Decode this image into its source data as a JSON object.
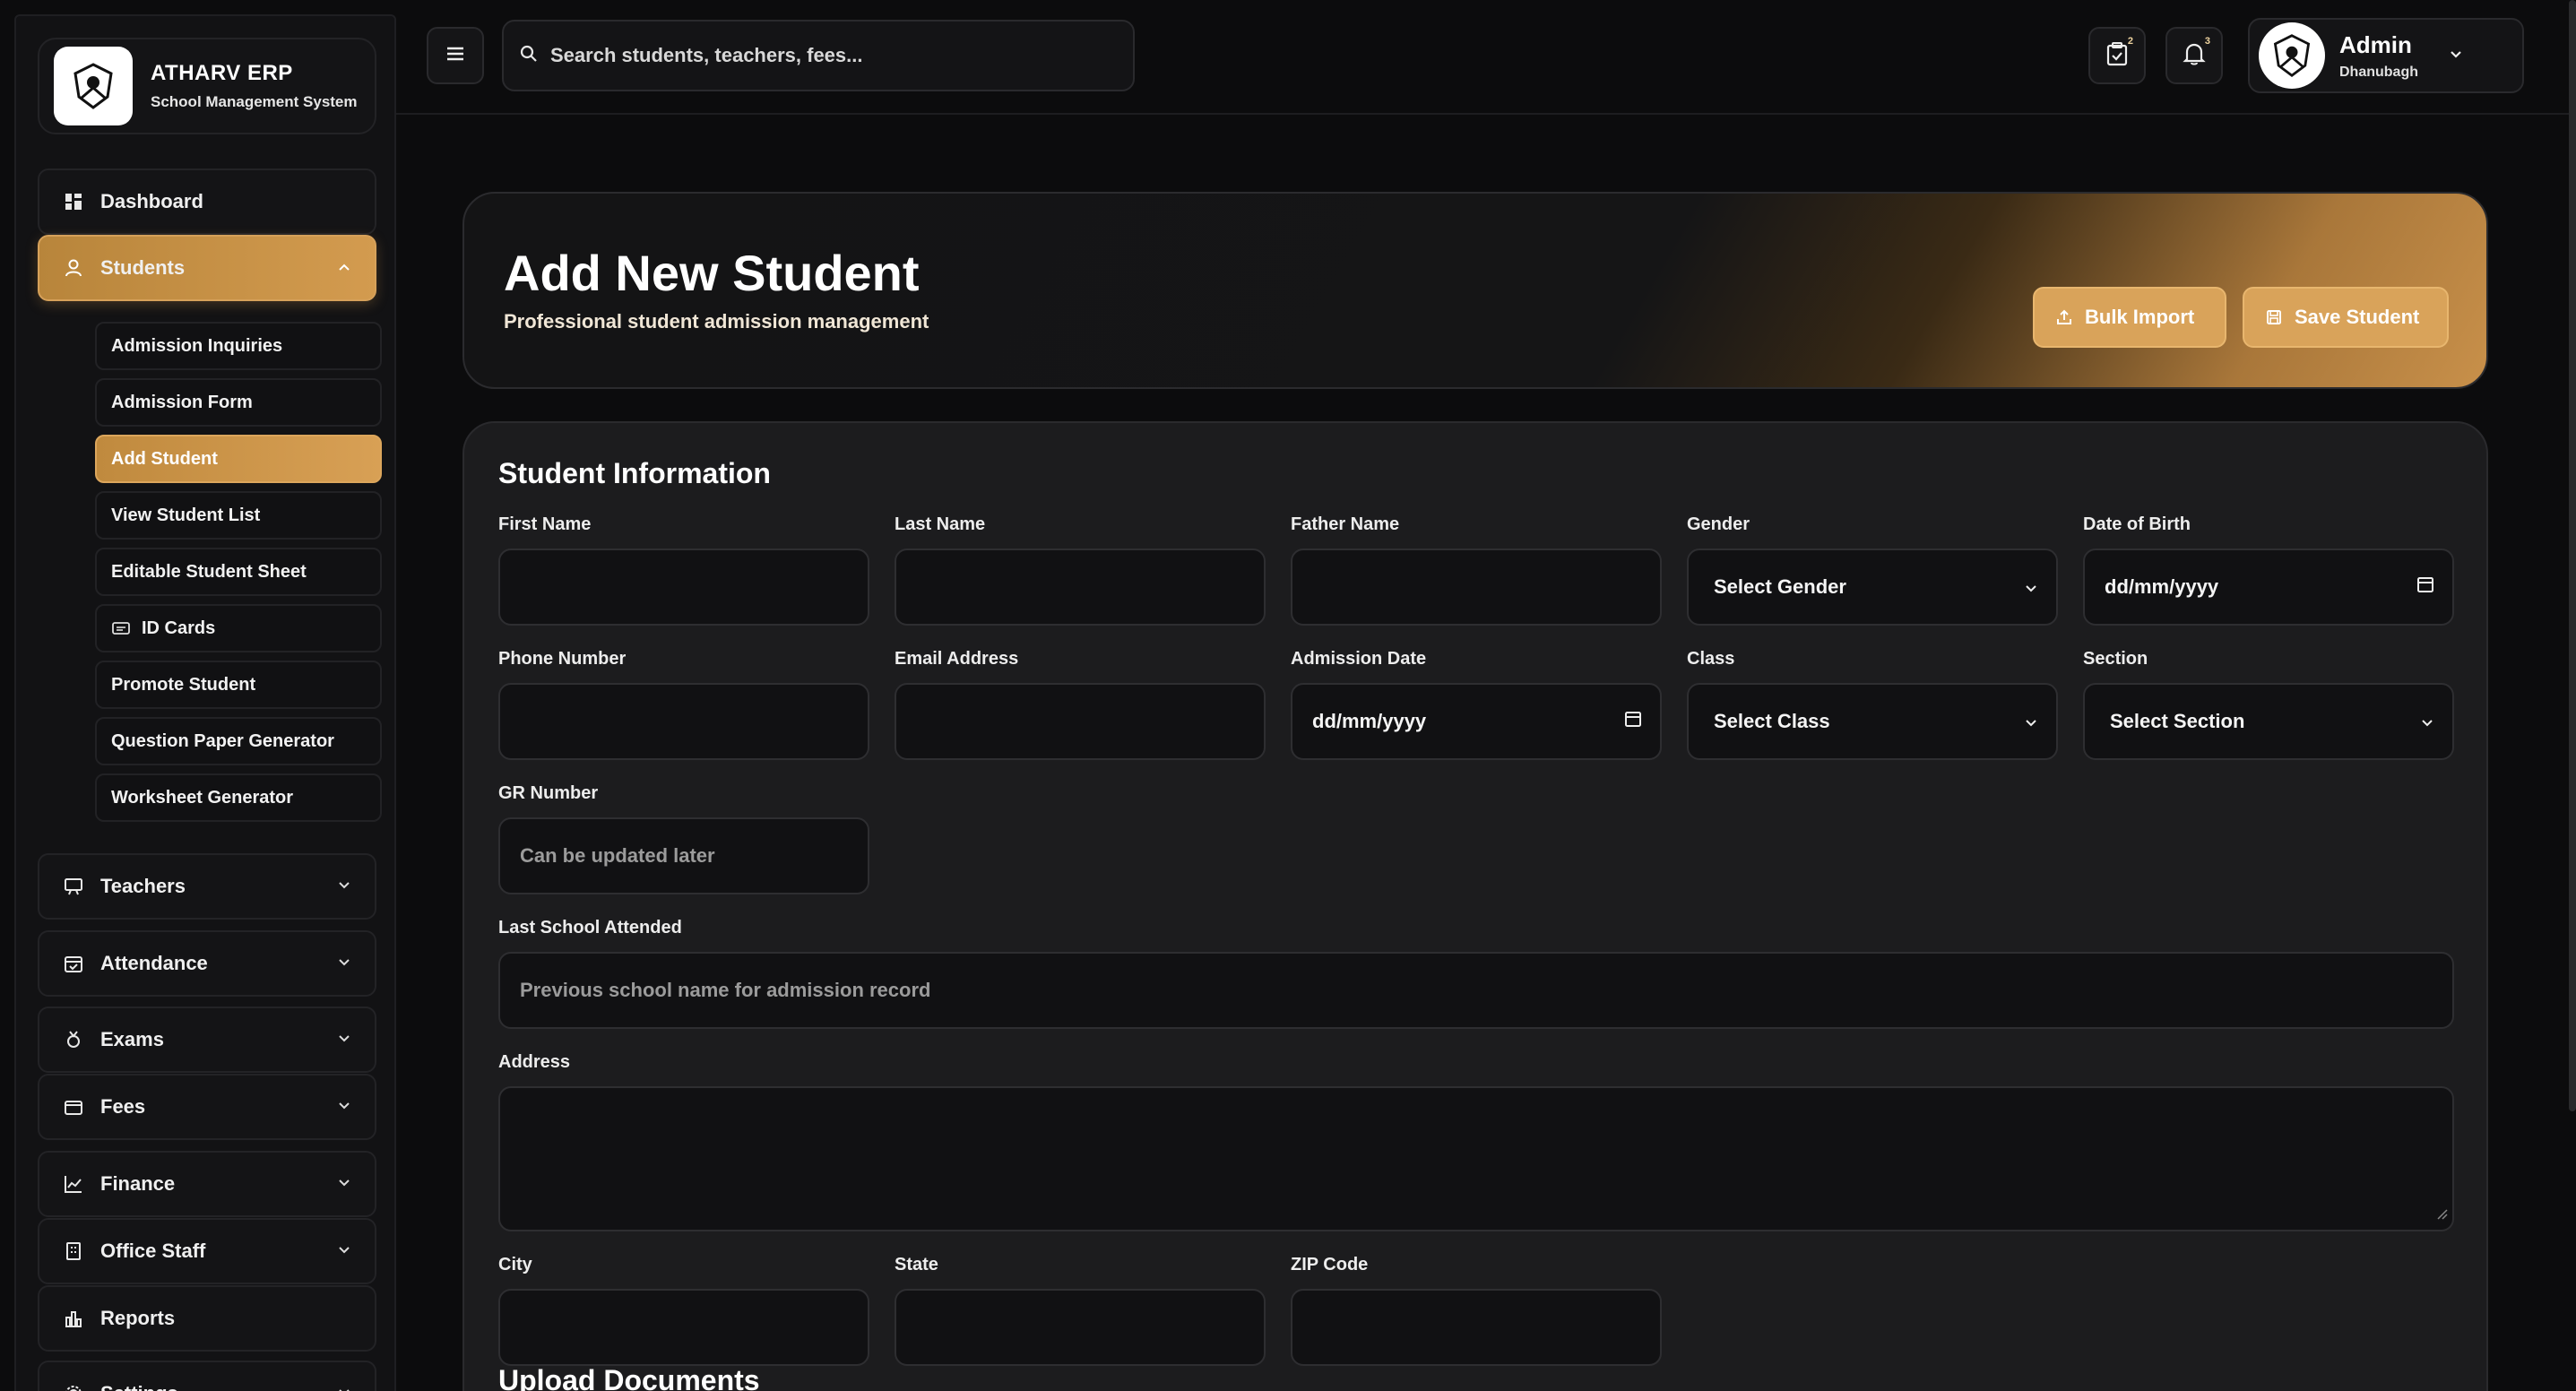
{
  "brand": {
    "title": "ATHARV ERP",
    "subtitle": "School Management System"
  },
  "header": {
    "search_placeholder": "Search students, teachers, fees...",
    "tasks_badge": "2",
    "notifications_badge": "3",
    "user": {
      "name": "Admin",
      "subtitle": "Dhanubagh"
    }
  },
  "sidebar": {
    "dashboard": "Dashboard",
    "students": "Students",
    "student_sub": [
      "Admission Inquiries",
      "Admission Form",
      "Add Student",
      "View Student List",
      "Editable Student Sheet",
      "ID Cards",
      "Promote Student",
      "Question Paper Generator",
      "Worksheet Generator"
    ],
    "teachers": "Teachers",
    "attendance": "Attendance",
    "exams": "Exams",
    "fees": "Fees",
    "finance": "Finance",
    "office_staff": "Office Staff",
    "reports": "Reports",
    "settings": "Settings"
  },
  "hero": {
    "title": "Add New Student",
    "subtitle": "Professional student admission management",
    "bulk_import": "Bulk Import",
    "save_student": "Save Student"
  },
  "form": {
    "section_title": "Student Information",
    "labels": {
      "first_name": "First Name",
      "last_name": "Last Name",
      "father_name": "Father Name",
      "gender": "Gender",
      "dob": "Date of Birth",
      "phone": "Phone Number",
      "email": "Email Address",
      "admission_date": "Admission Date",
      "class": "Class",
      "section": "Section",
      "gr_number": "GR Number",
      "last_school": "Last School Attended",
      "address": "Address",
      "city": "City",
      "state": "State",
      "zip": "ZIP Code"
    },
    "values": {
      "gender": "Select Gender",
      "dob": "dd/mm/yyyy",
      "admission_date": "dd/mm/yyyy",
      "class": "Select Class",
      "section": "Select Section"
    },
    "placeholders": {
      "gr_number": "Can be updated later",
      "last_school": "Previous school name for admission record"
    },
    "upload_title": "Upload Documents"
  },
  "colors": {
    "accent": "#d39b4f",
    "background": "#0c0c0d",
    "card": "#1c1c1e"
  }
}
